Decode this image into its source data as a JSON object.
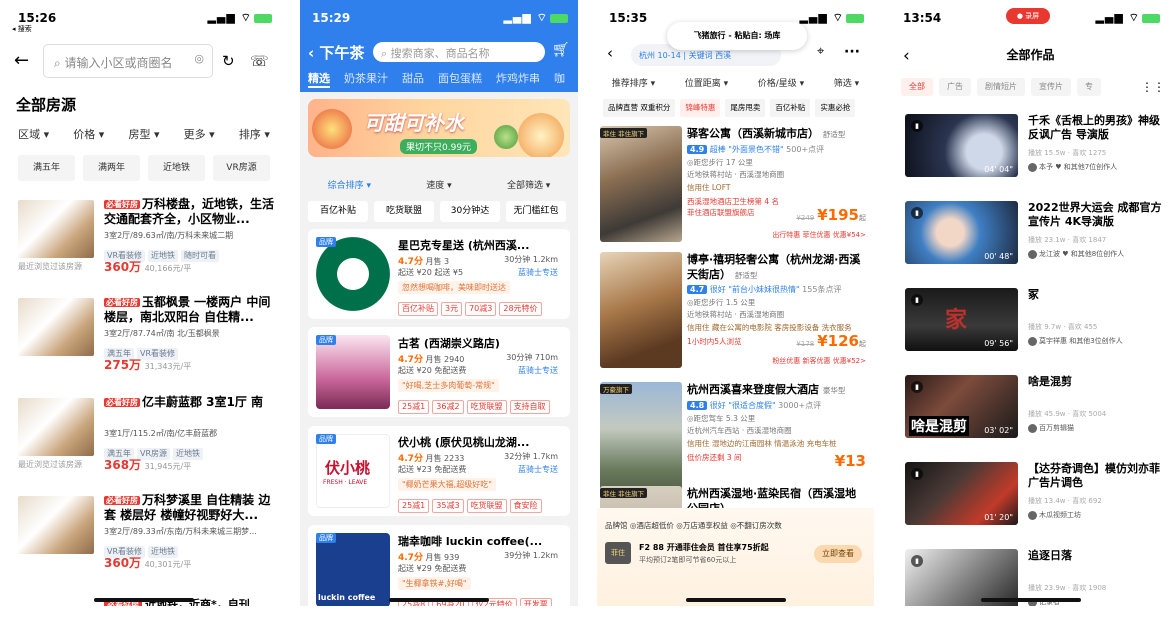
{
  "p1": {
    "time": "15:26",
    "sub": "◂ 搜索",
    "signal": "▂▄▆ ⌔",
    "search_placeholder": "请输入小区或商圈名",
    "title": "全部房源",
    "filters": [
      "区域",
      "价格",
      "房型",
      "更多",
      "排序"
    ],
    "chips": [
      "满五年",
      "满两年",
      "近地铁",
      "VR房源"
    ],
    "badge": "必看好房",
    "recent": "最近浏览过该房源",
    "listings": [
      {
        "title": "万科楼盘，近地铁，生活交通配套齐全，小区物业...",
        "detail": "3室2厅/89.63㎡/南/万科未来城二期",
        "tags": [
          "VR看装修",
          "近地铁",
          "随时可看"
        ],
        "price": "360万",
        "unit": "40,166元/平",
        "recent": true
      },
      {
        "title": "玉都枫景 一楼两户 中间楼层，南北双阳台 自住精...",
        "detail": "3室2厅/87.74㎡/南 北/玉都枫景",
        "tags": [
          "满五年",
          "VR看装修"
        ],
        "price": "275万",
        "unit": "31,343元/平",
        "recent": false
      },
      {
        "title": "亿丰蔚蓝郡 3室1厅 南",
        "detail": "3室1厅/115.2㎡/南/亿丰蔚蓝郡",
        "tags": [
          "满五年",
          "VR房源",
          "近地铁"
        ],
        "price": "368万",
        "unit": "31,945元/平",
        "recent": true
      },
      {
        "title": "万科梦溪里 自住精装 边套 楼层好 楼幢好视野好大...",
        "detail": "3室2厅/89.33㎡/东南/万科未来城三期梦...",
        "tags": [
          "VR看装修",
          "近地铁"
        ],
        "price": "360万",
        "unit": "40,301元/平",
        "recent": false
      }
    ],
    "last": "近地铁，近商*，自刊"
  },
  "p2": {
    "time": "15:29",
    "signal": "▂▄▆ ⌔",
    "back_title": "下午茶",
    "search": "搜索商家、商品名称",
    "cats": [
      "精选",
      "奶茶果汁",
      "甜品",
      "面包蛋糕",
      "炸鸡炸串",
      "咖"
    ],
    "banner_title": "可甜可补水",
    "banner_sub": "果切不只0.99元",
    "sort": [
      "综合排序 ▾",
      "速度 ▾",
      "全部筛选 ▾"
    ],
    "tabs": [
      "百亿补贴",
      "吃货联盟",
      "30分钟达",
      "无门槛红包"
    ],
    "pin": "品牌",
    "shops": [
      {
        "name": "星巴克专星送 (杭州西溪...",
        "score": "4.7分",
        "sales": "月售 3",
        "right": "30分钟 1.2km",
        "l3": "起送 ¥20  起送 ¥5",
        "l3r": "蓝骑士专送",
        "l4": "忽然想喝咖啡，美味即时送达",
        "tags": [
          "百亿补贴",
          "3元",
          "70减3",
          "28元特价"
        ]
      },
      {
        "name": "古茗 (西湖崇义路店)",
        "score": "4.7分",
        "sales": "月售 2940",
        "right": "30分钟 710m",
        "l3": "起送 ¥20  免配送费",
        "l3r": "蓝骑士专送",
        "l4": "\"好喝,芝士多肉葡萄-常规\"",
        "tags": [
          "25减1",
          "36减2",
          "吃货联盟",
          "支持自取"
        ]
      },
      {
        "name": "伏小桃 (原伏见桃山龙湖...",
        "score": "4.7分",
        "sales": "月售 2233",
        "right": "32分钟 1.7km",
        "l3": "起送 ¥23  免配送费",
        "l3r": "蓝骑士专送",
        "l4": "\"椰奶芒果大福,超级好吃\"",
        "tags": [
          "25减1",
          "35减3",
          "吃货联盟",
          "食安险"
        ]
      },
      {
        "name": "瑞幸咖啡 luckin coffee(...",
        "score": "4.7分",
        "sales": "月售 939",
        "right": "39分钟 1.2km",
        "l3": "起送 ¥29  免配送费",
        "l3r": "",
        "l4": "\"生椰拿铁#,好喝\"",
        "tags": [
          "25减8",
          "69减20",
          "仅2元特价",
          "开发票"
        ]
      }
    ],
    "logo_text": [
      "伏小桃",
      "FRESH · LEAVE",
      "luckin coffee"
    ]
  },
  "p3": {
    "time": "15:35",
    "signal": "▂▄▆ ⌔",
    "toast": "飞猪旅行 - 粘贴自: 场库",
    "city": "杭州  10-14 | 关键词 西溪",
    "filters": [
      "推荐排序 ▾",
      "位置距离 ▾",
      "价格/星级 ▾",
      "筛选 ▾"
    ],
    "chips": [
      "品牌直营 双重积分",
      "锦峰特惠",
      "尾房甩卖",
      "百亿补贴",
      "实惠必抢"
    ],
    "hotels": [
      {
        "flag": "菲住 菲住旗下",
        "name": "驿客公寓（西溪新城市店）",
        "type": "舒适型",
        "rate": "4.9",
        "rtxt": "超棒 \"外面景色不错\"",
        "cnt": "500+点评",
        "l1": "◎距您步行 17 公里",
        "l2": "近地铁蒋村站 · 西溪湿地商圈",
        "l3": "信用住  LOFT",
        "l4": "西溪湿地酒店卫生榜第 4 名",
        "l5": "菲住酒店联盟旗舰店",
        "orig": "¥249",
        "price": "¥195",
        "unit": "起",
        "bottom": "出行特惠  菲住优惠  优惠¥54>"
      },
      {
        "flag": "",
        "name": "博亭·禧玥轻奢公寓（杭州龙湖·西溪天街店）",
        "type": "舒适型",
        "rate": "4.7",
        "rtxt": "很好 \"前台小妹妹很热情\"",
        "cnt": "155条点评",
        "l1": "◎距您步行 1.5 公里",
        "l2": "近地铁蒋村站 · 西溪湿地商圈",
        "l3": "信用住  藏在公寓的电影院  客房投影设备  洗衣服务",
        "l4": "1小时内5人浏览",
        "l5": "",
        "orig": "¥178",
        "price": "¥126",
        "unit": "起",
        "bottom": "粉丝优惠  新客优惠  优惠¥52>"
      },
      {
        "flag": "万豪旗下",
        "name": "杭州西溪喜来登度假大酒店",
        "type": "豪华型",
        "rate": "4.8",
        "rtxt": "很好 \"很适合度假\"",
        "cnt": "3000+点评",
        "l1": "◎距您驾车 5.3 公里",
        "l2": "近杭州汽车西站 · 西溪湿地商圈",
        "l3": "信用住  湿地边的江南园林  情温泳池  充电车桩",
        "l4": "低价房还剩 3 间",
        "l5": "",
        "orig": "",
        "price": "¥13",
        "unit": "",
        "bottom": ""
      },
      {
        "flag": "菲住 菲住旗下",
        "name": "杭州西溪湿地·蓝染民宿（西溪湿地公园店）",
        "type": "",
        "rate": "",
        "rtxt": "",
        "cnt": "",
        "l1": "",
        "l2": "",
        "l3": "",
        "l4": "",
        "l5": "",
        "orig": "",
        "price": "",
        "unit": "",
        "bottom": ""
      }
    ],
    "member": {
      "row1": "品牌馆  ◎酒店超低价  ◎万店通享权益  ◎不翻订房次数",
      "box": "菲住",
      "row2": "F2 88 开通菲住会员 首住享75折起",
      "row3": "平均预订2笔即可节省60元以上",
      "btn": "立即查看"
    }
  },
  "p4": {
    "time": "13:54",
    "signal": "▂▄▆ ⌔",
    "rec": "● 录屏",
    "title": "全部作品",
    "tabs": [
      "全部",
      "广告",
      "剧情短片",
      "宣传片",
      "专"
    ],
    "videos": [
      {
        "title": "千禾《舌根上的男孩》神级反讽广告 导演版",
        "stats": "播放 15.5w · 喜欢 1275",
        "author": "本予 ♥ 和其他7位创作人",
        "dur": "04' 04\""
      },
      {
        "title": "2022世界大运会 成都官方宣传片 4K导演版",
        "stats": "播放 23.1w · 喜欢 1847",
        "author": "龙江波 ♥ 和其他8位创作人",
        "dur": "00' 48\""
      },
      {
        "title": "冢",
        "stats": "播放 9.7w · 喜欢 455",
        "author": "莫宇祥惠 和其他3位创作人",
        "dur": "09' 56\""
      },
      {
        "title": "啥是混剪",
        "stats": "播放 45.9w · 喜欢 5004",
        "author": "百万剪辑猫",
        "dur": "03' 02\""
      },
      {
        "title": "【达芬奇调色】模仿刘亦菲广告片调色",
        "stats": "播放 13.4w · 喜欢 692",
        "author": "木瓜视频工坊",
        "dur": "01' 20\""
      },
      {
        "title": "追逐日落",
        "stats": "播放 23.9w · 喜欢 1908",
        "author": "记录者",
        "dur": ""
      }
    ],
    "overlay_text": [
      "家",
      "啥是混剪"
    ]
  }
}
